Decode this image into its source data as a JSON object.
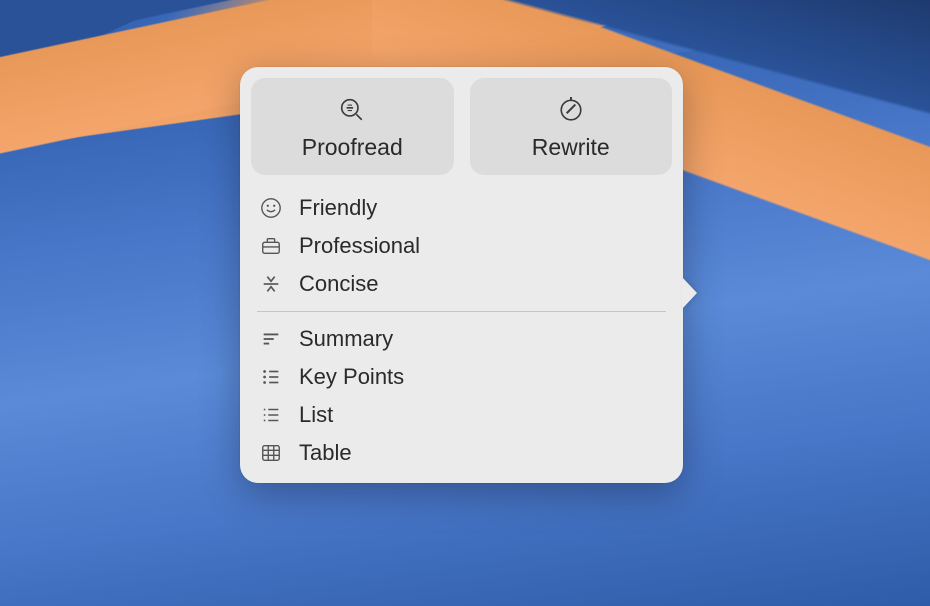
{
  "buttons": {
    "proofread": "Proofread",
    "rewrite": "Rewrite"
  },
  "style_options": [
    {
      "id": "friendly",
      "label": "Friendly",
      "icon": "smile-icon"
    },
    {
      "id": "professional",
      "label": "Professional",
      "icon": "briefcase-icon"
    },
    {
      "id": "concise",
      "label": "Concise",
      "icon": "compress-icon"
    }
  ],
  "format_options": [
    {
      "id": "summary",
      "label": "Summary",
      "icon": "summary-icon"
    },
    {
      "id": "keypoints",
      "label": "Key Points",
      "icon": "bullets-icon"
    },
    {
      "id": "list",
      "label": "List",
      "icon": "list-icon"
    },
    {
      "id": "table",
      "label": "Table",
      "icon": "table-icon"
    }
  ]
}
